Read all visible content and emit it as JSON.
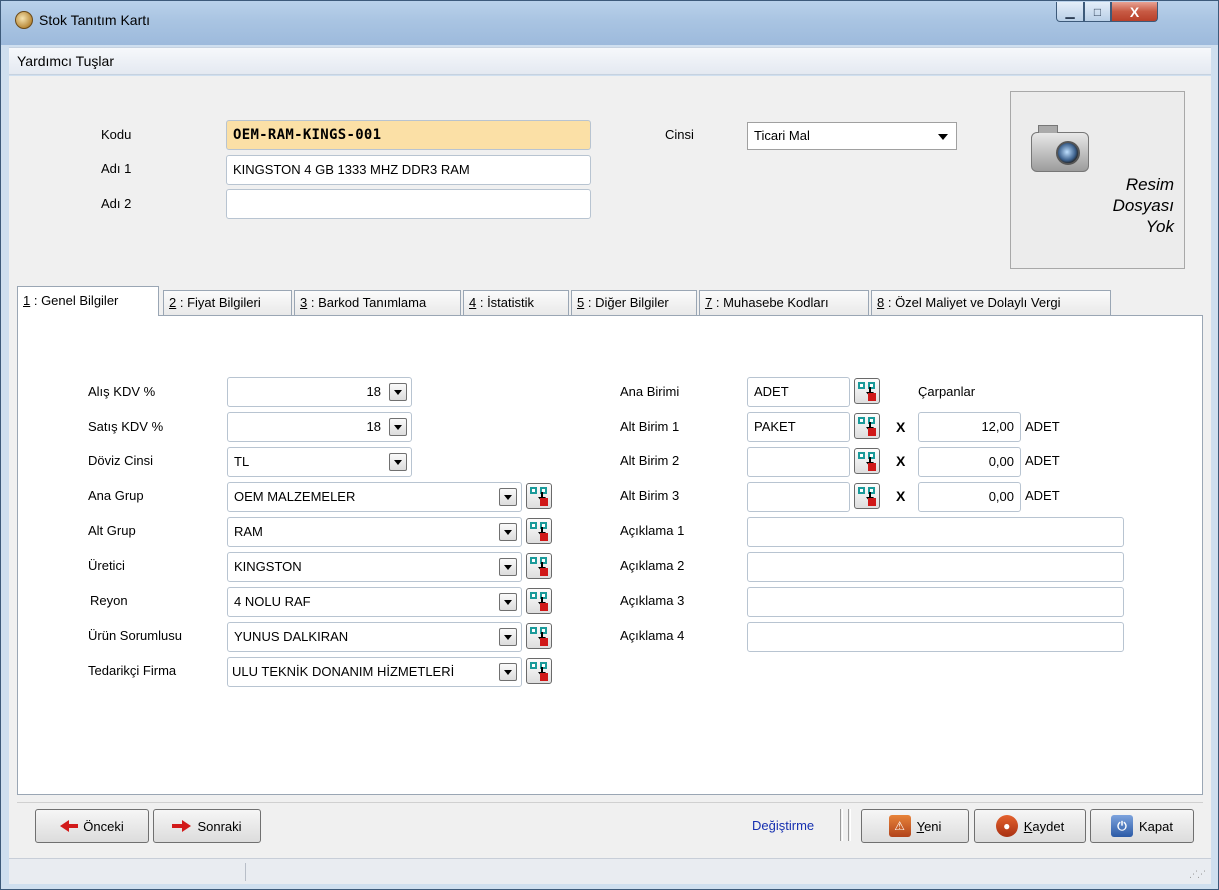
{
  "window": {
    "title": "Stok Tanıtım Kartı",
    "min_glyph": "▁",
    "max_glyph": "□",
    "close_glyph": "X"
  },
  "menu": {
    "helper_keys": "Yardımcı Tuşlar"
  },
  "header": {
    "code_label": "Kodu",
    "code_value": "OEM-RAM-KINGS-001",
    "name1_label": "Adı 1",
    "name1_value": "KINGSTON 4 GB 1333 MHZ DDR3 RAM",
    "name2_label": "Adı 2",
    "name2_value": "",
    "type_label": "Cinsi",
    "type_value": "Ticari Mal",
    "image_placeholder": {
      "line1": "Resim",
      "line2": "Dosyası",
      "line3": "Yok"
    }
  },
  "tabs": [
    {
      "key": "1",
      "label": " : Genel Bilgiler",
      "active": true
    },
    {
      "key": "2",
      "label": " : Fiyat Bilgileri",
      "active": false
    },
    {
      "key": "3",
      "label": " : Barkod Tanımlama",
      "active": false
    },
    {
      "key": "4",
      "label": " : İstatistik",
      "active": false
    },
    {
      "key": "5",
      "label": " : Diğer Bilgiler",
      "active": false
    },
    {
      "key": "7",
      "label": " : Muhasebe Kodları",
      "active": false
    },
    {
      "key": "8",
      "label": " : Özel Maliyet ve Dolaylı Vergi",
      "active": false
    }
  ],
  "general": {
    "purchase_vat_label": "Alış KDV %",
    "purchase_vat_value": "18",
    "sales_vat_label": "Satış KDV %",
    "sales_vat_value": "18",
    "currency_label": "Döviz Cinsi",
    "currency_value": "TL",
    "main_group_label": "Ana Grup",
    "main_group_value": "OEM MALZEMELER",
    "sub_group_label": "Alt Grup",
    "sub_group_value": "RAM",
    "manufacturer_label": "Üretici",
    "manufacturer_value": "KINGSTON",
    "shelf_label": "Reyon",
    "shelf_value": "4 NOLU RAF",
    "responsible_label": "Ürün Sorumlusu",
    "responsible_value": "YUNUS DALKIRAN",
    "supplier_label": "Tedarikçi Firma",
    "supplier_value": "ULU TEKNİK DONANIM HİZMETLERİ"
  },
  "units": {
    "main_unit_label": "Ana Birimi",
    "main_unit_value": "ADET",
    "multipliers_label": "Çarpanlar",
    "rows": [
      {
        "label": "Alt Birim 1",
        "value": "PAKET",
        "x": "X",
        "multiplier": "12,00",
        "unit": "ADET"
      },
      {
        "label": "Alt Birim 2",
        "value": "",
        "x": "X",
        "multiplier": "0,00",
        "unit": "ADET"
      },
      {
        "label": "Alt Birim 3",
        "value": "",
        "x": "X",
        "multiplier": "0,00",
        "unit": "ADET"
      }
    ],
    "descriptions": [
      {
        "label": "Açıklama 1",
        "value": ""
      },
      {
        "label": "Açıklama 2",
        "value": ""
      },
      {
        "label": "Açıklama 3",
        "value": ""
      },
      {
        "label": "Açıklama 4",
        "value": ""
      }
    ]
  },
  "toolbar": {
    "prev_label": "Önceki",
    "next_label": "Sonraki",
    "mode_text": "Değiştirme",
    "new_key": "Y",
    "new_rest": "eni",
    "save_key": "K",
    "save_rest": "aydet",
    "close_label": "Kapat"
  },
  "colors": {
    "code_field_bg": "#fbe0a6",
    "title_bar": "#a9c4e2",
    "close_button": "#c75a44",
    "mode_link": "#1630b0"
  }
}
